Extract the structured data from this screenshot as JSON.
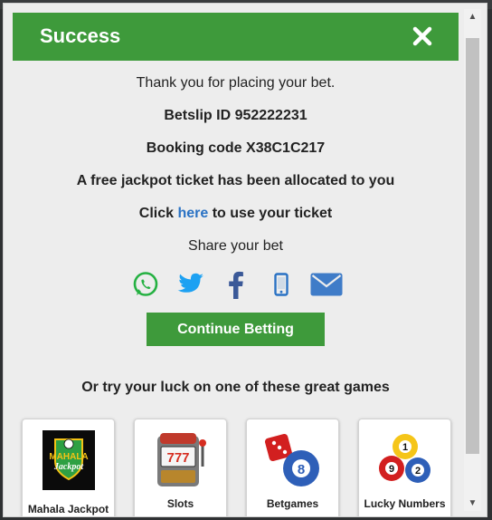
{
  "modal": {
    "title": "Success",
    "thank_you": "Thank you for placing your bet.",
    "betslip": "Betslip ID 952222231",
    "booking": "Booking code X38C1C217",
    "jackpot_note": "A free jackpot ticket has been allocated to you",
    "click_prefix": "Click ",
    "click_link": "here",
    "click_suffix": " to use your ticket",
    "share_label": "Share your bet",
    "share_icons": [
      "whatsapp-icon",
      "twitter-icon",
      "facebook-icon",
      "mobile-icon",
      "email-icon"
    ],
    "continue_label": "Continue Betting",
    "games_prompt": "Or try your luck on one of these great games"
  },
  "games": [
    {
      "label": "Mahala Jackpot",
      "logo_text_1": "MAHALA",
      "logo_text_2": "Jackpot"
    },
    {
      "label": "Slots",
      "logo_text": "777"
    },
    {
      "label": "Betgames",
      "logo_text": "8"
    },
    {
      "label": "Lucky Numbers",
      "balls": [
        "1",
        "9",
        "2"
      ]
    }
  ],
  "colors": {
    "header": "#3e9a3b",
    "button": "#3e9a3b",
    "link": "#2a72c4",
    "whatsapp": "#25b142",
    "twitter": "#1da1f2",
    "facebook": "#3b5998",
    "email": "#3f7cc8"
  }
}
